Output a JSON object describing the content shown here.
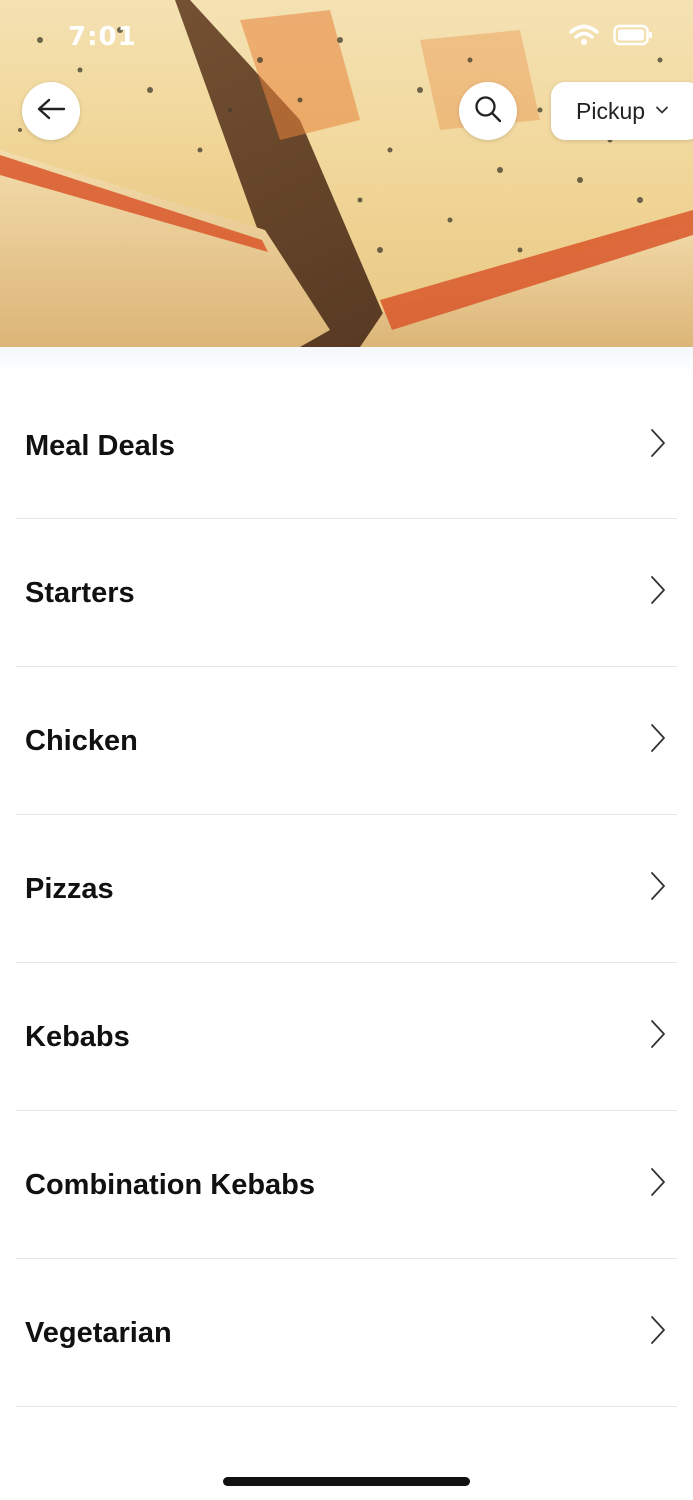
{
  "status_bar": {
    "time": "7:01"
  },
  "header": {
    "back_icon": "arrow-left-icon",
    "search_icon": "search-icon",
    "mode_selector": {
      "selected": "Pickup",
      "icon": "chevron-down-icon"
    }
  },
  "menu": {
    "categories": [
      {
        "label": "Meal Deals"
      },
      {
        "label": "Starters"
      },
      {
        "label": "Chicken"
      },
      {
        "label": "Pizzas"
      },
      {
        "label": "Kebabs"
      },
      {
        "label": "Combination Kebabs"
      },
      {
        "label": "Vegetarian"
      }
    ]
  },
  "colors": {
    "text": "#111111",
    "divider": "#e4e4e4",
    "background": "#ffffff"
  }
}
